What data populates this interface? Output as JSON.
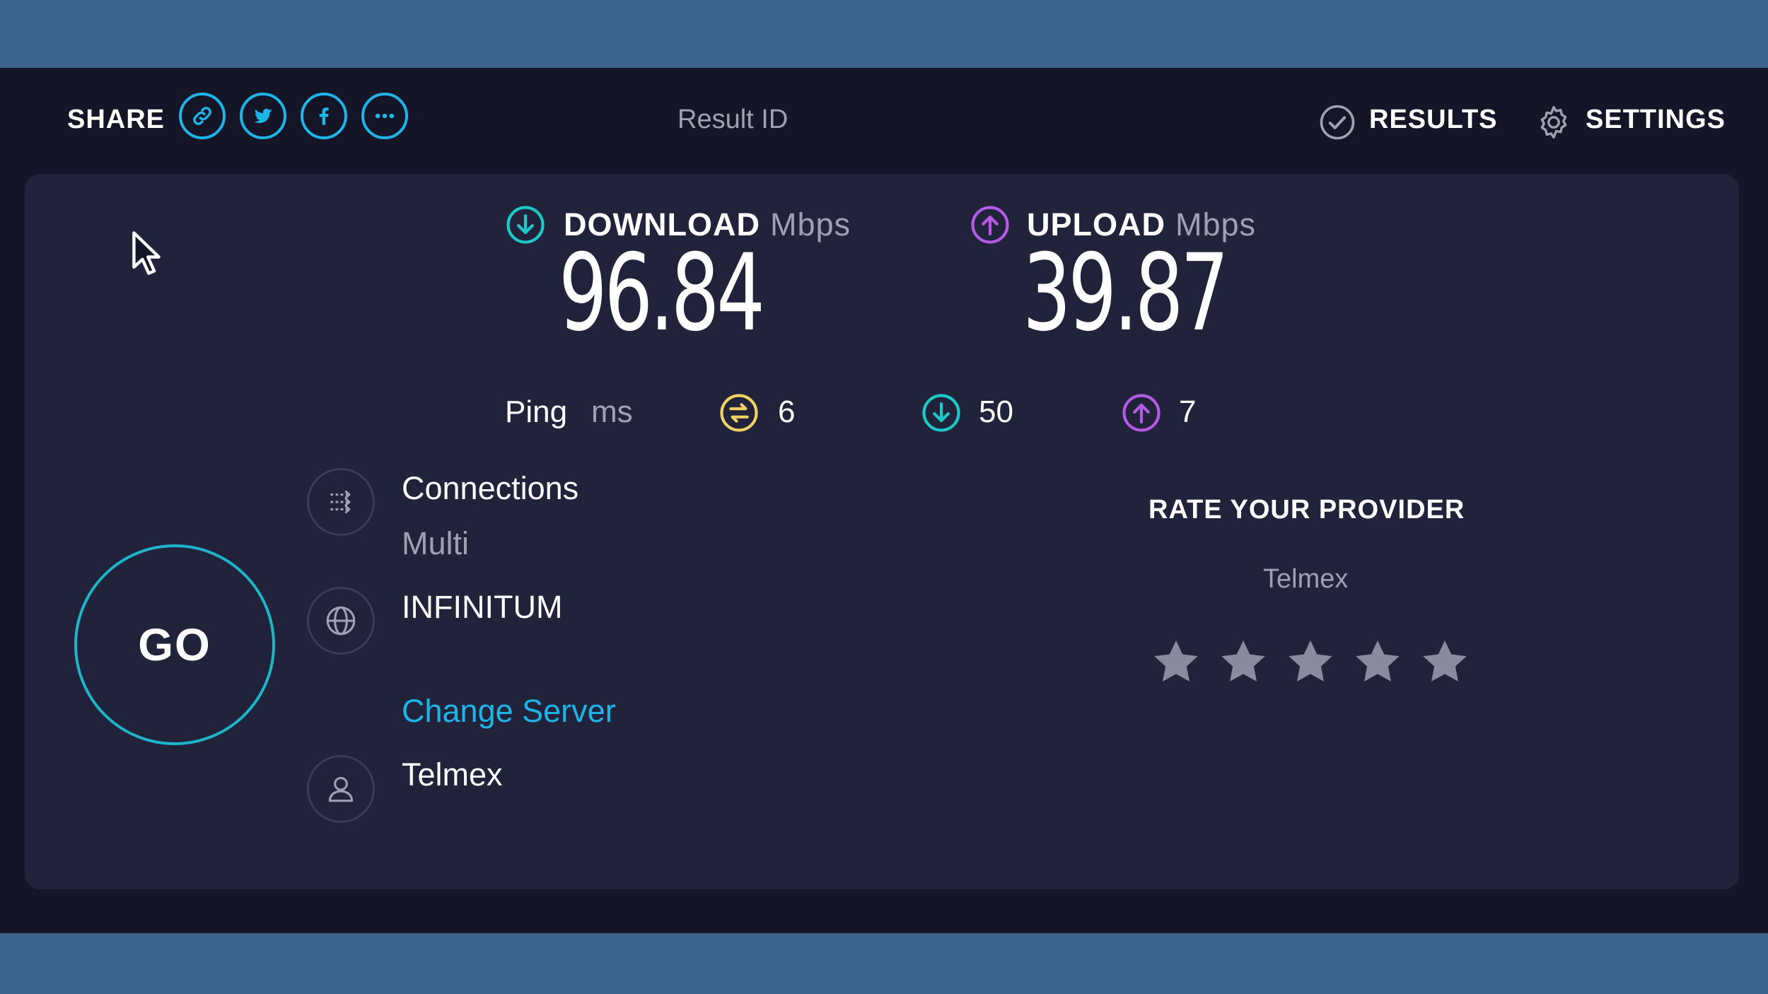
{
  "header": {
    "share_label": "SHARE",
    "share_icons": [
      "link-icon",
      "twitter-icon",
      "facebook-icon",
      "more-icon"
    ],
    "result_id_label": "Result ID",
    "results_label": "RESULTS",
    "settings_label": "SETTINGS"
  },
  "download": {
    "label": "DOWNLOAD",
    "unit": "Mbps",
    "value": "96.84"
  },
  "upload": {
    "label": "UPLOAD",
    "unit": "Mbps",
    "value": "39.87"
  },
  "ping": {
    "label": "Ping",
    "unit": "ms",
    "idle": "6",
    "download": "50",
    "upload": "7"
  },
  "go_label": "GO",
  "connections": {
    "title": "Connections",
    "value": "Multi"
  },
  "server": {
    "name": "INFINITUM",
    "change_label": "Change Server"
  },
  "provider": {
    "name": "Telmex"
  },
  "rate": {
    "title": "RATE YOUR PROVIDER",
    "provider": "Telmex",
    "stars_total": 5,
    "stars_selected": 0
  },
  "colors": {
    "accent_blue": "#1fb4e8",
    "download": "#1fc8c8",
    "upload": "#b45ae6",
    "ping_idle": "#f0d264",
    "card": "#21233a",
    "background": "#141527",
    "frame": "#3d648c"
  }
}
